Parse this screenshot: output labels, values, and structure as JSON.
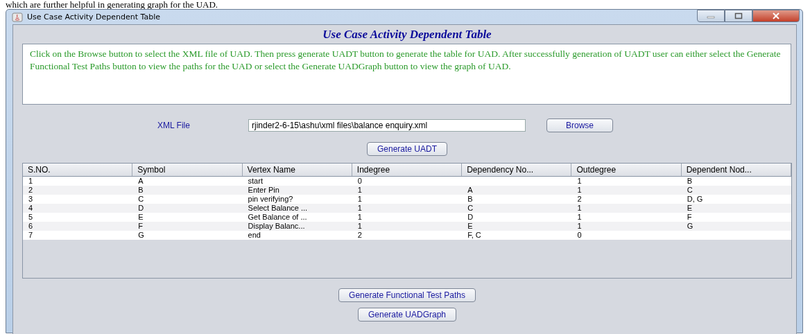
{
  "document_text": "which are further helpful in generating graph for the UAD.",
  "window": {
    "title": "Use Case Activity Dependent Table"
  },
  "heading": "Use Case Activity Dependent Table",
  "instructions": "Click on the Browse button to select the XML file of UAD. Then press generate UADT button to generate the table for UAD. After successfully generation of UADT user can either select the Generate Functional Test Paths button to view the paths for the UAD or select the Generate UADGraph button to view the graph of UAD.",
  "xml_file": {
    "label": "XML File",
    "value": "rjinder2-6-15\\ashu\\xml files\\balance enquiry.xml",
    "browse_button": "Browse"
  },
  "generate_button": "Generate UADT",
  "table": {
    "columns": [
      "S.NO.",
      "Symbol",
      "Vertex Name",
      "Indegree",
      "Dependency No...",
      "Outdegree",
      "Dependent Nod..."
    ],
    "rows": [
      [
        "1",
        "A",
        "start",
        "0",
        "",
        "1",
        "B"
      ],
      [
        "2",
        "B",
        "Enter Pin",
        "1",
        "A",
        "1",
        "C"
      ],
      [
        "3",
        "C",
        "pin verifying?",
        "1",
        "B",
        "2",
        "D, G"
      ],
      [
        "4",
        "D",
        "Select Balance ...",
        "1",
        "C",
        "1",
        "E"
      ],
      [
        "5",
        "E",
        "Get Balance of ...",
        "1",
        "D",
        "1",
        "F"
      ],
      [
        "6",
        "F",
        "Display Balanc...",
        "1",
        "E",
        "1",
        "G"
      ],
      [
        "7",
        "G",
        "end",
        "2",
        "F, C",
        "0",
        ""
      ]
    ]
  },
  "bottom_buttons": [
    "Generate Functional Test Paths",
    "Generate UADGraph"
  ]
}
